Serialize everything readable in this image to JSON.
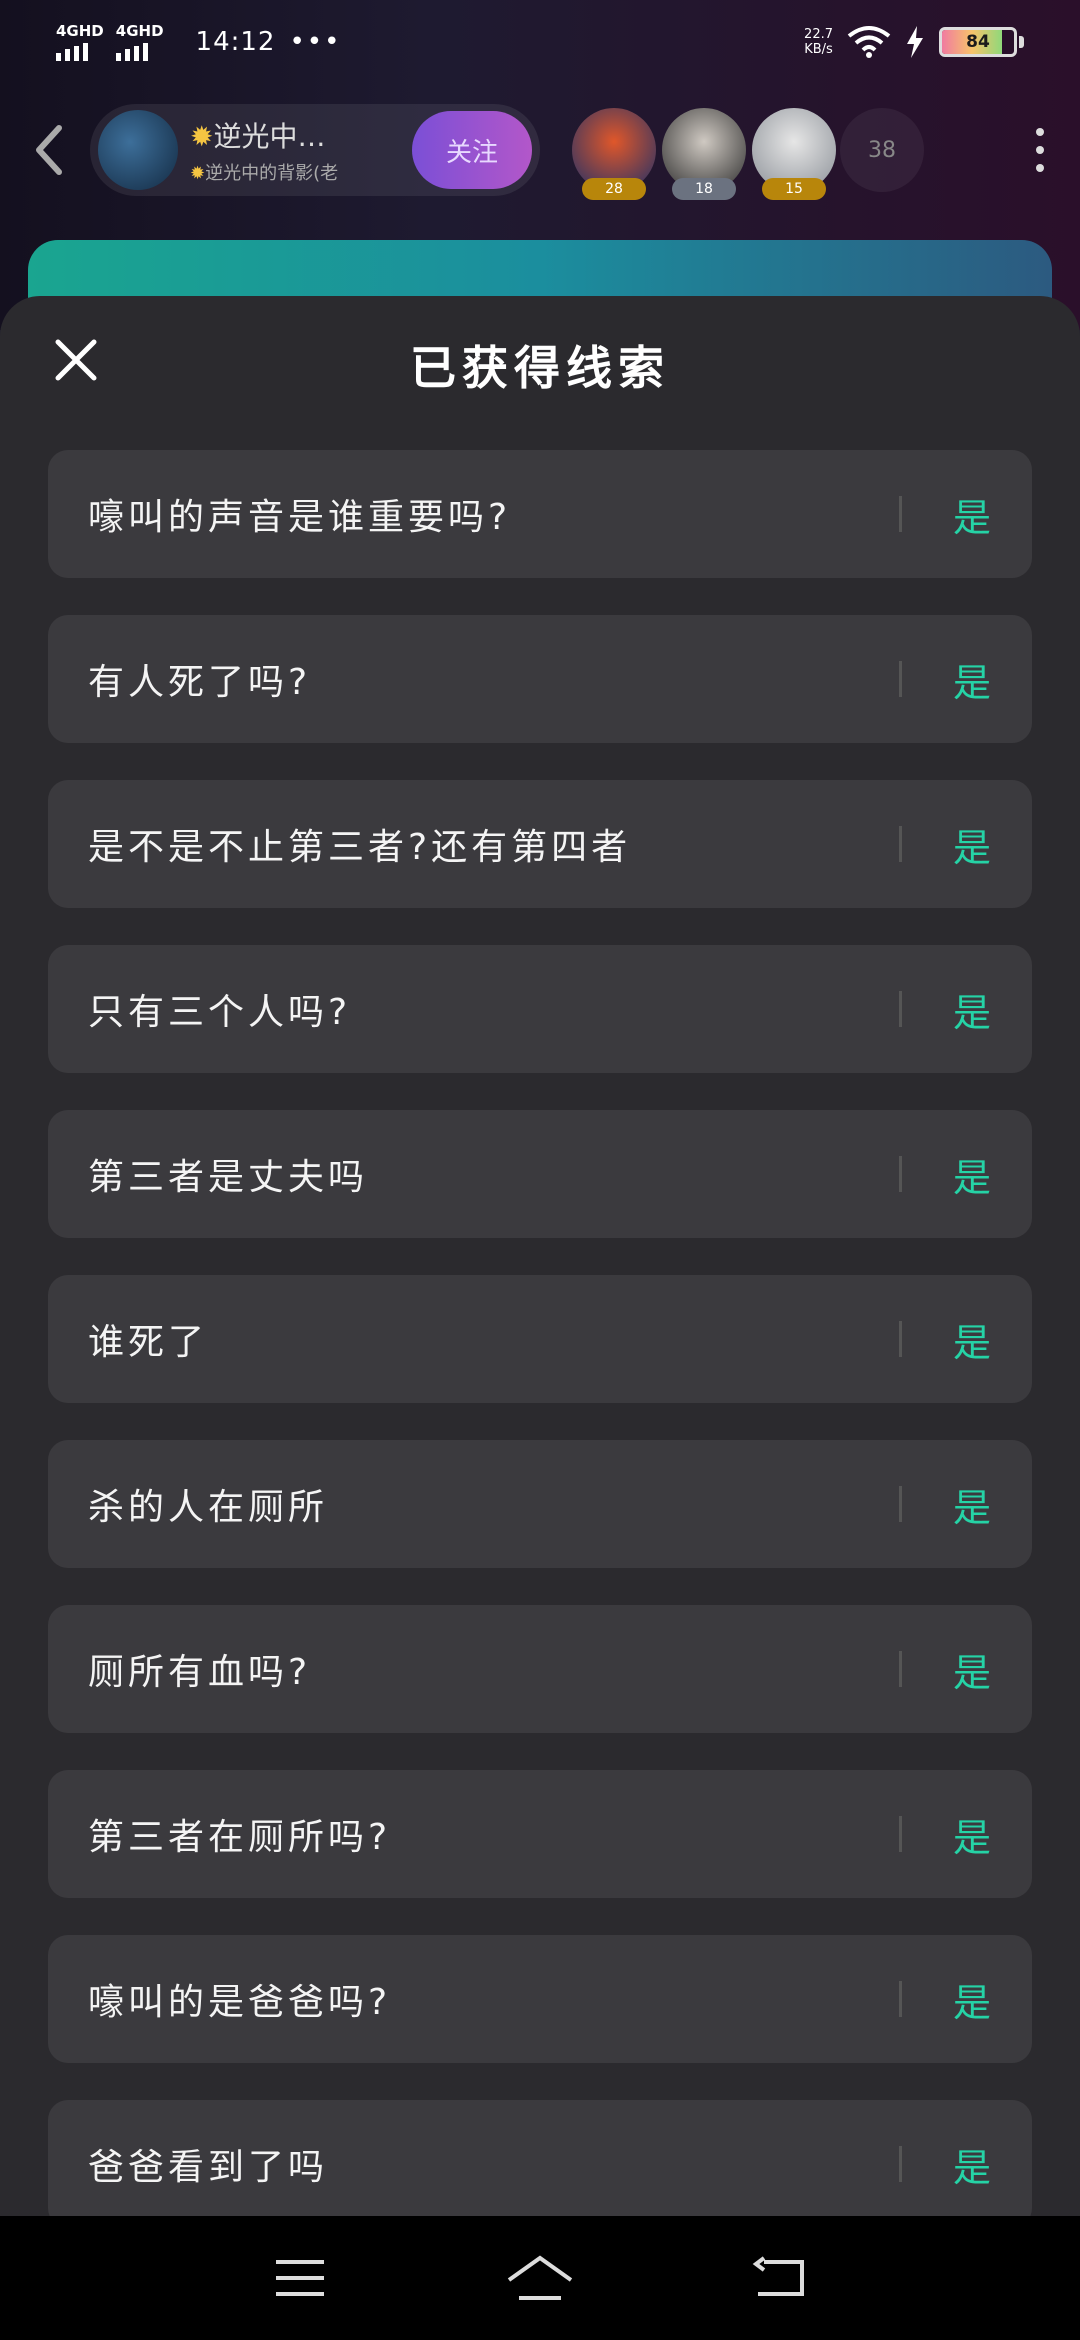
{
  "status_bar": {
    "sim1": "4GHD",
    "sim2": "4GHD",
    "time": "14:12",
    "overflow": "•••",
    "net_speed_value": "22.7",
    "net_speed_unit": "KB/s",
    "battery_level": "84",
    "battery_fraction": 0.84
  },
  "room": {
    "host_name": "逆光中…",
    "host_sub": "逆光中的背影(老",
    "follow_label": "关注",
    "viewers": [
      {
        "level": "28",
        "badge_color": "#b8860b",
        "avatar_colors": [
          "#e0572a",
          "#1a2f6a"
        ]
      },
      {
        "level": "18",
        "badge_color": "#6b7280",
        "avatar_colors": [
          "#cfc9c2",
          "#2a2a2a"
        ]
      },
      {
        "level": "15",
        "badge_color": "#b8860b",
        "avatar_colors": [
          "#e6e6e6",
          "#8a8f96"
        ]
      }
    ],
    "viewer_count": "38"
  },
  "sheet": {
    "title": "已获得线索",
    "answer_color": "#25d3a6",
    "clues": [
      {
        "question": "嚎叫的声音是谁重要吗?",
        "answer": "是"
      },
      {
        "question": "有人死了吗?",
        "answer": "是"
      },
      {
        "question": "是不是不止第三者?还有第四者",
        "answer": "是"
      },
      {
        "question": "只有三个人吗?",
        "answer": "是"
      },
      {
        "question": "第三者是丈夫吗",
        "answer": "是"
      },
      {
        "question": "谁死了",
        "answer": "是"
      },
      {
        "question": "杀的人在厕所",
        "answer": "是"
      },
      {
        "question": "厕所有血吗?",
        "answer": "是"
      },
      {
        "question": "第三者在厕所吗?",
        "answer": "是"
      },
      {
        "question": "嚎叫的是爸爸吗?",
        "answer": "是"
      },
      {
        "question": "爸爸看到了吗",
        "answer": "是"
      }
    ]
  },
  "icons": {
    "close": "close-icon",
    "back": "back-arrow-icon",
    "more": "more-vertical-icon",
    "nav_menu": "menu-icon",
    "nav_home": "home-icon",
    "nav_back": "back-icon"
  }
}
